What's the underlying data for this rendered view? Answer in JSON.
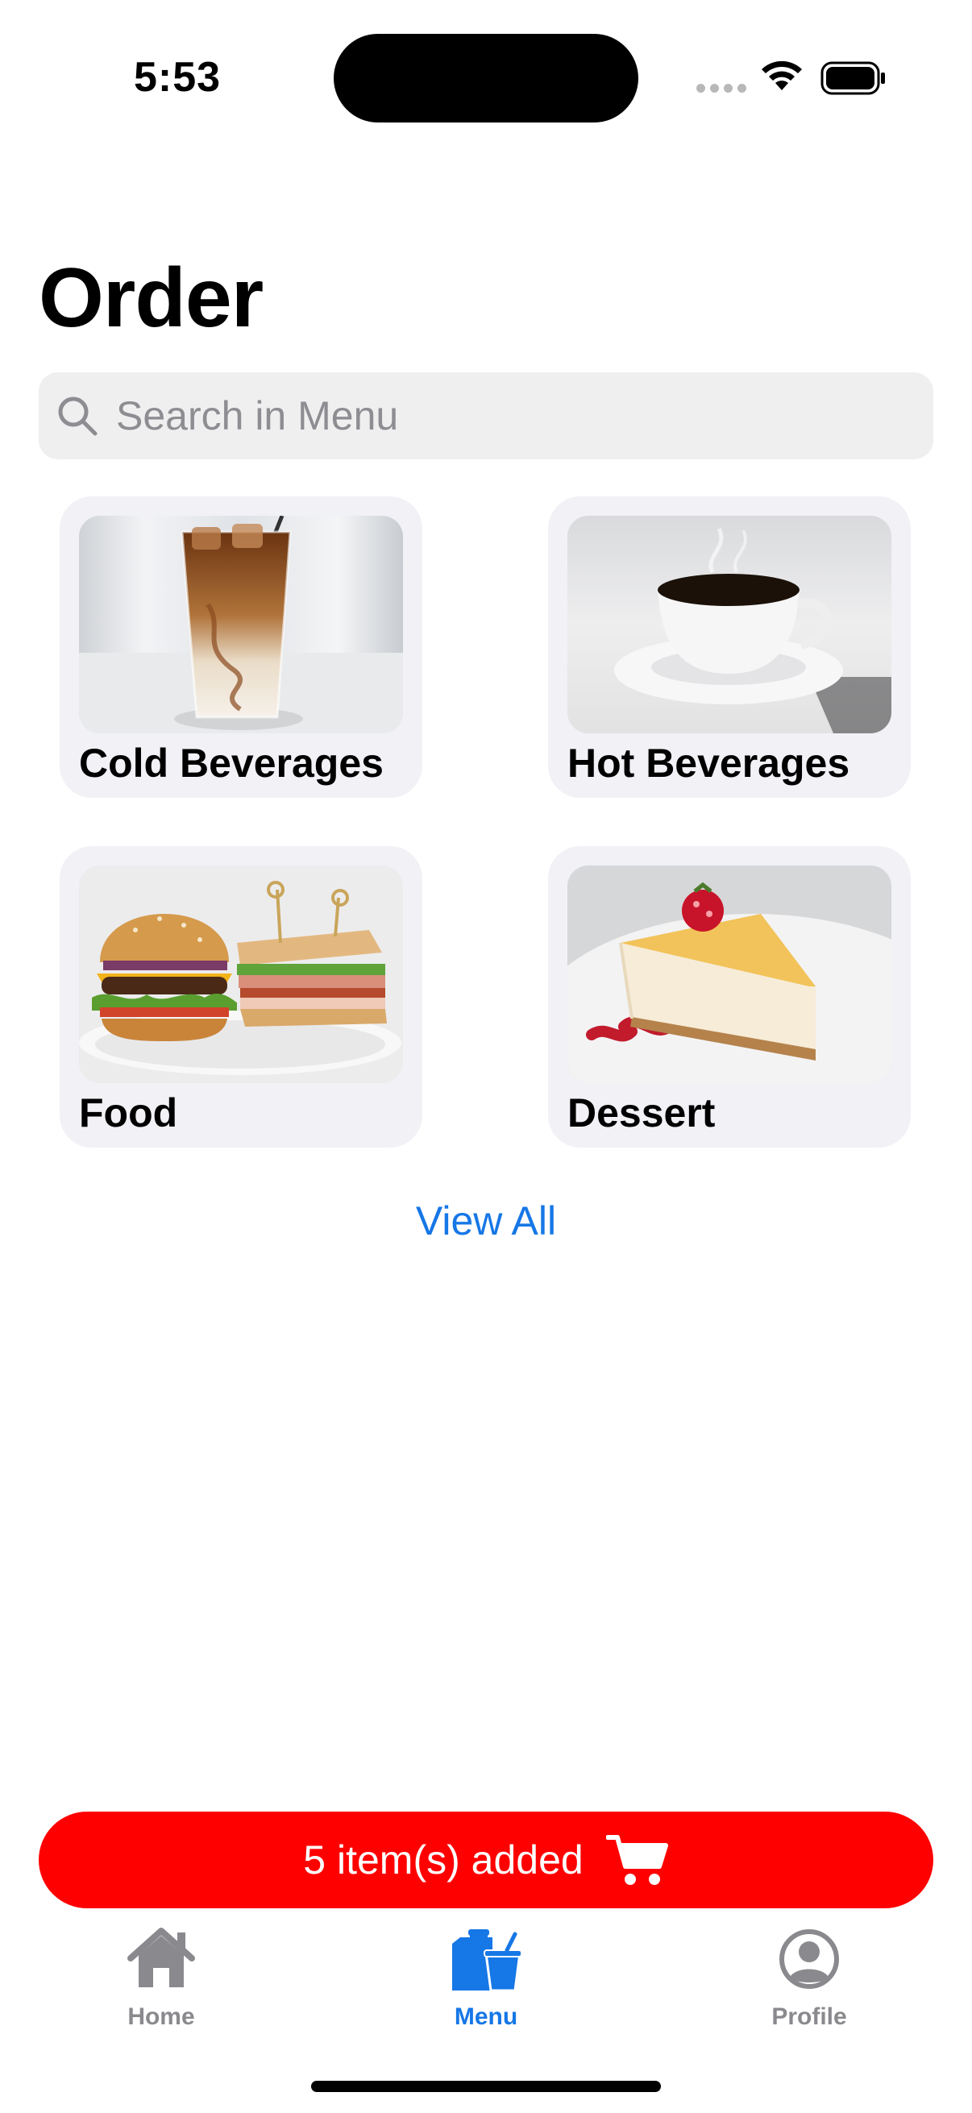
{
  "status_bar": {
    "time": "5:53"
  },
  "page": {
    "title": "Order"
  },
  "search": {
    "placeholder": "Search in Menu",
    "value": ""
  },
  "categories": [
    {
      "label": "Cold Beverages"
    },
    {
      "label": "Hot Beverages"
    },
    {
      "label": "Food"
    },
    {
      "label": "Dessert"
    }
  ],
  "view_all_label": "View All",
  "cart": {
    "label": "5 item(s) added"
  },
  "tab_bar": {
    "items": [
      {
        "label": "Home",
        "icon": "house-icon",
        "active": false
      },
      {
        "label": "Menu",
        "icon": "menu-bag-cup-icon",
        "active": true
      },
      {
        "label": "Profile",
        "icon": "person-circle-icon",
        "active": false
      }
    ]
  },
  "colors": {
    "accent": "#1677e6",
    "cart_background": "#ff0000",
    "card_background": "#f1f1f6",
    "search_background": "#efeff0",
    "inactive_tab": "#8a8a8e"
  }
}
